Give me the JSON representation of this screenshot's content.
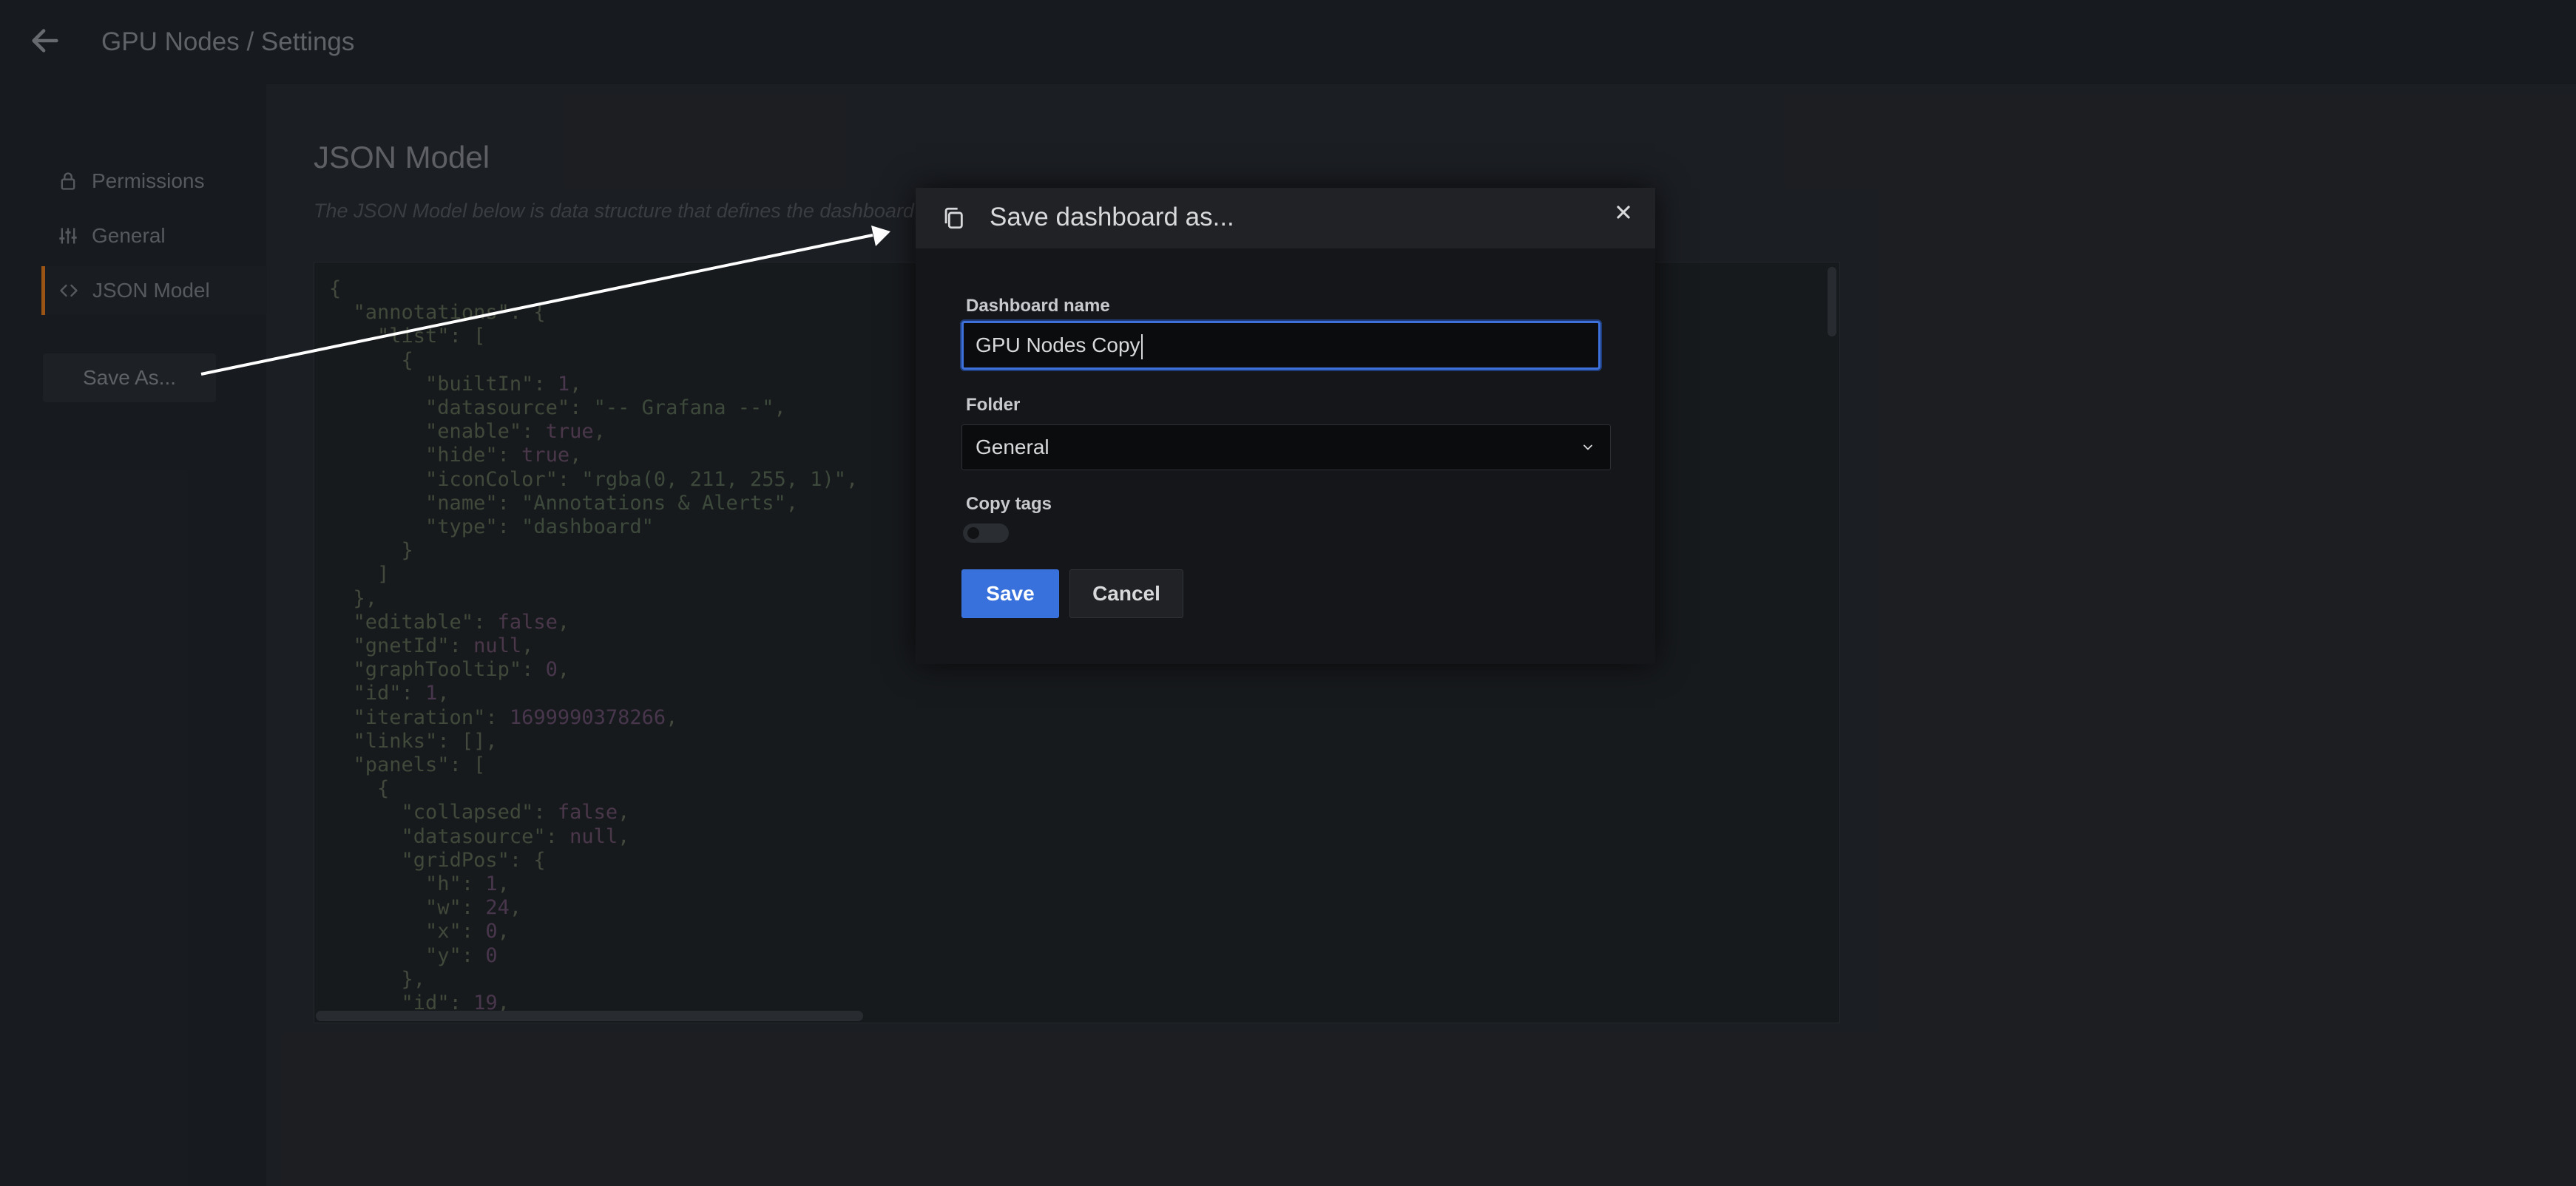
{
  "header": {
    "title": "GPU Nodes / Settings"
  },
  "sidebar": {
    "items": [
      {
        "label": "Permissions",
        "icon": "lock-icon"
      },
      {
        "label": "General",
        "icon": "sliders-icon"
      },
      {
        "label": "JSON Model",
        "icon": "code-icon"
      }
    ],
    "save_as_label": "Save As..."
  },
  "main": {
    "title": "JSON Model",
    "subtitle": "The JSON Model below is data structure that defines the dashboard"
  },
  "editor": {
    "lines": [
      "{",
      "  \"annotations\": {",
      "    \"list\": [",
      "      {",
      "        \"builtIn\": 1,",
      "        \"datasource\": \"-- Grafana --\",",
      "        \"enable\": true,",
      "        \"hide\": true,",
      "        \"iconColor\": \"rgba(0, 211, 255, 1)\",",
      "        \"name\": \"Annotations & Alerts\",",
      "        \"type\": \"dashboard\"",
      "      }",
      "    ]",
      "  },",
      "  \"editable\": false,",
      "  \"gnetId\": null,",
      "  \"graphTooltip\": 0,",
      "  \"id\": 1,",
      "  \"iteration\": 1699990378266,",
      "  \"links\": [],",
      "  \"panels\": [",
      "    {",
      "      \"collapsed\": false,",
      "      \"datasource\": null,",
      "      \"gridPos\": {",
      "        \"h\": 1,",
      "        \"w\": 24,",
      "        \"x\": 0,",
      "        \"y\": 0",
      "      },",
      "      \"id\": 19,"
    ]
  },
  "modal": {
    "title": "Save dashboard as...",
    "icon": "copy-icon",
    "name_label": "Dashboard name",
    "name_value": "GPU Nodes Copy",
    "folder_label": "Folder",
    "folder_value": "General",
    "copy_tags_label": "Copy tags",
    "copy_tags_on": false,
    "save_label": "Save",
    "cancel_label": "Cancel"
  },
  "colors": {
    "primary": "#3871dc",
    "active_tab_accent": "#eb7b18",
    "annotation_arrow": "#ffffff"
  }
}
